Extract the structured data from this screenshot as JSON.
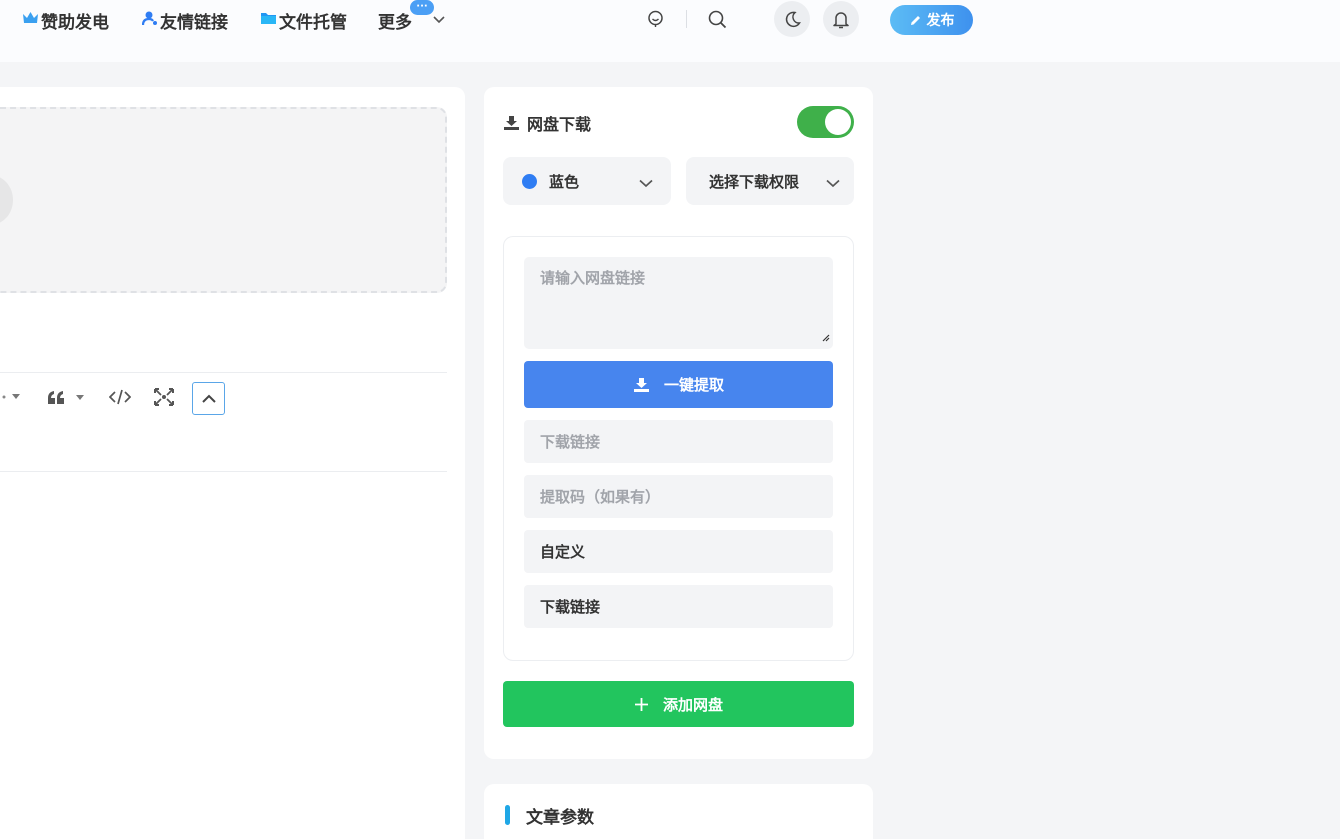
{
  "nav": {
    "items": [
      {
        "label": "赞助发电",
        "icon": "crown-icon"
      },
      {
        "label": "友情链接",
        "icon": "user-icon"
      },
      {
        "label": "文件托管",
        "icon": "folder-icon"
      },
      {
        "label": "更多",
        "icon": "chevron-down-icon"
      }
    ],
    "more_badge": "···",
    "publish_label": "发布"
  },
  "netdisk": {
    "title": "网盘下载",
    "enabled": true,
    "color_select": "蓝色",
    "color_value": "#2f7df3",
    "permission_select": "选择下载权限",
    "link_placeholder": "请输入网盘链接",
    "extract_button": "一键提取",
    "download_link_placeholder": "下载链接",
    "extract_code_placeholder": "提取码（如果有）",
    "custom_label": "自定义",
    "custom_value": "下载链接",
    "add_button": "添加网盘"
  },
  "article_params": {
    "title": "文章参数"
  },
  "colors": {
    "accent": "#4785ee",
    "success": "#22c55e",
    "toggle_on": "#3fb04a"
  }
}
